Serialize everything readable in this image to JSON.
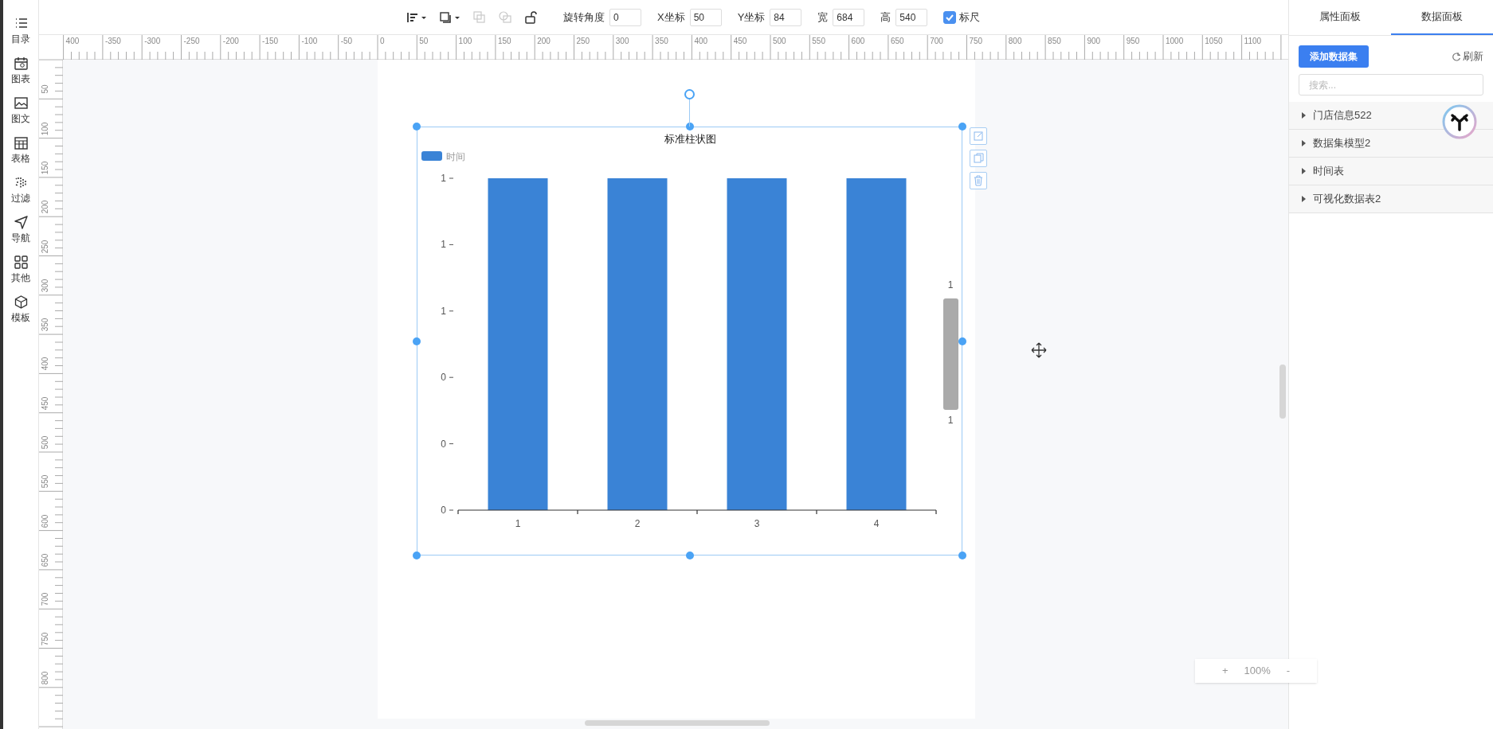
{
  "sidebar": {
    "items": [
      {
        "label": "目录"
      },
      {
        "label": "图表"
      },
      {
        "label": "图文"
      },
      {
        "label": "表格"
      },
      {
        "label": "过滤"
      },
      {
        "label": "导航"
      },
      {
        "label": "其他"
      },
      {
        "label": "模板"
      }
    ]
  },
  "toolbar": {
    "tools": [
      {
        "kind": "align",
        "disabled": false
      },
      {
        "kind": "layer",
        "disabled": false
      },
      {
        "kind": "copy",
        "disabled": true
      },
      {
        "kind": "group",
        "disabled": true
      },
      {
        "kind": "lock",
        "disabled": false
      }
    ],
    "fields": [
      {
        "label": "旋转角度",
        "value": "0"
      },
      {
        "label": "X坐标",
        "value": "50"
      },
      {
        "label": "Y坐标",
        "value": "84"
      },
      {
        "label": "宽",
        "value": "684"
      },
      {
        "label": "高",
        "value": "540"
      }
    ],
    "ruler_toggle": {
      "label": "标尺",
      "checked": true
    }
  },
  "rulers": {
    "horizontal": [
      "400",
      "-350",
      "-300",
      "-250",
      "-200",
      "-150",
      "-100",
      "-50",
      "0",
      "50",
      "100",
      "150",
      "200",
      "250",
      "300",
      "350",
      "400",
      "450",
      "500",
      "550",
      "600",
      "650",
      "700",
      "750",
      "800",
      "850",
      "900",
      "950",
      "1000",
      "1050",
      "1100"
    ],
    "vertical": [
      "50",
      "100",
      "150",
      "200",
      "250",
      "300",
      "350",
      "400",
      "450",
      "500",
      "550",
      "600",
      "650",
      "700",
      "750",
      "800"
    ]
  },
  "chart_widget": {
    "selected": true,
    "chart_data": {
      "type": "bar",
      "title": "标准柱状图",
      "categories": [
        "1",
        "2",
        "3",
        "4"
      ],
      "series": [
        {
          "name": "时间",
          "color": "#3a83d6",
          "values": [
            1,
            1,
            1,
            1
          ]
        }
      ],
      "ylim": [
        0,
        1
      ],
      "yticks": [
        {
          "value": 0,
          "label": "0"
        },
        {
          "value": 0.2,
          "label": "0"
        },
        {
          "value": 0.4,
          "label": "0"
        },
        {
          "value": 0.6,
          "label": "1"
        },
        {
          "value": 0.8,
          "label": "1"
        },
        {
          "value": 1,
          "label": "1"
        }
      ]
    },
    "slider": {
      "start_label": "1",
      "end_label": "1"
    }
  },
  "zoom_control": {
    "zoom_in": "+",
    "level": "100%",
    "zoom_out": "-"
  },
  "right_panel": {
    "tabs": [
      {
        "label": "属性面板",
        "selected": false
      },
      {
        "label": "数据面板",
        "selected": true
      }
    ],
    "add_button": "添加数据集",
    "refresh": "刷新",
    "search": {
      "placeholder": "搜索..."
    },
    "datasets": [
      {
        "name": "门店信息522",
        "expanded": false
      },
      {
        "name": "数据集模型2",
        "expanded": false
      },
      {
        "name": "时间表",
        "expanded": false
      },
      {
        "name": "可视化数据表2",
        "expanded": false
      }
    ]
  }
}
